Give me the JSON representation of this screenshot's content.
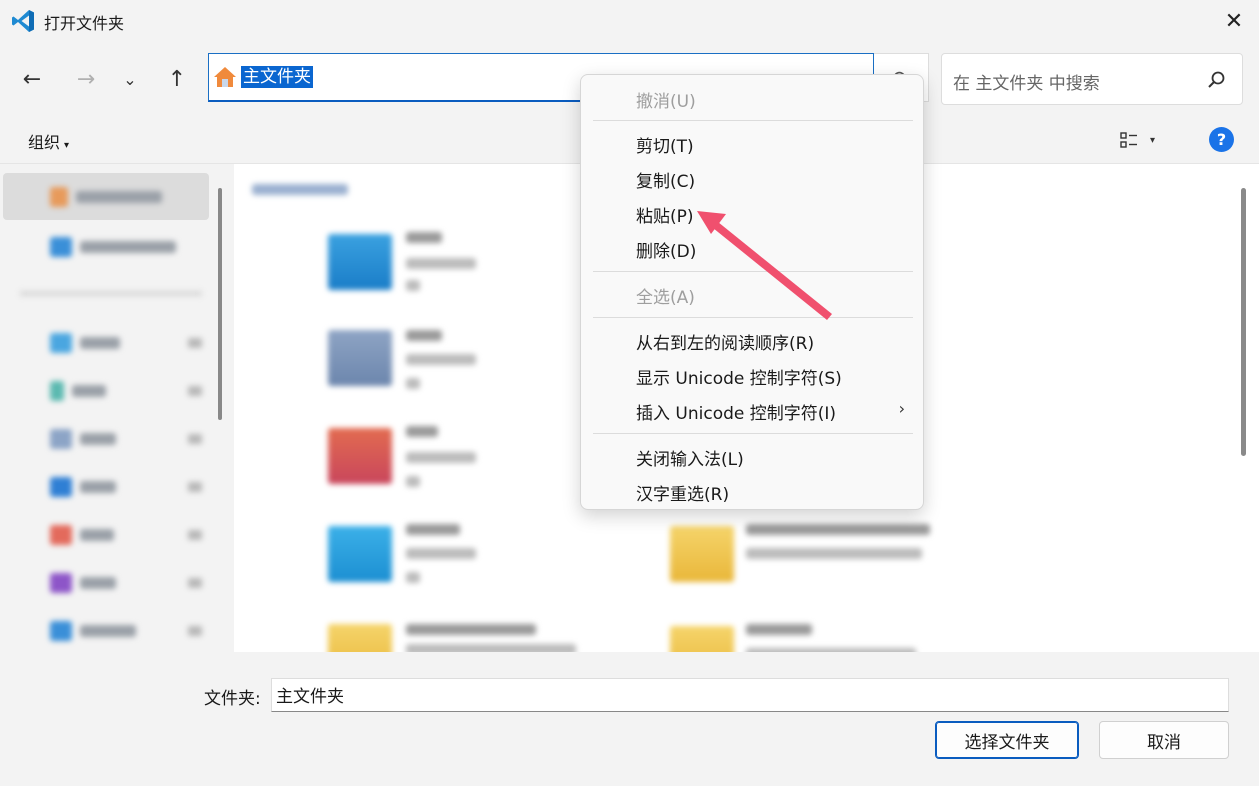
{
  "window": {
    "title": "打开文件夹",
    "close_glyph": "✕"
  },
  "nav": {
    "back_glyph": "←",
    "forward_glyph": "→",
    "recent_glyph": "⌄",
    "up_glyph": "↑",
    "address": "主文件夹",
    "address_chevron": "⌄",
    "refresh_glyph": "⟳",
    "search_placeholder": "在 主文件夹 中搜索"
  },
  "commandbar": {
    "organize": "组织",
    "organize_caret": "▾",
    "view_caret": "▾",
    "help": "?"
  },
  "context_menu": {
    "items": [
      {
        "label": "撤消(U)",
        "enabled": false
      },
      {
        "label": "剪切(T)",
        "enabled": true
      },
      {
        "label": "复制(C)",
        "enabled": true
      },
      {
        "label": "粘贴(P)",
        "enabled": true
      },
      {
        "label": "删除(D)",
        "enabled": true
      },
      {
        "label": "全选(A)",
        "enabled": false
      },
      {
        "label": "从右到左的阅读顺序(R)",
        "enabled": true
      },
      {
        "label": "显示 Unicode 控制字符(S)",
        "enabled": true
      },
      {
        "label": "插入 Unicode 控制字符(I)",
        "enabled": true,
        "has_submenu": true
      },
      {
        "label": "关闭输入法(L)",
        "enabled": true
      },
      {
        "label": "汉字重选(R)",
        "enabled": true
      }
    ],
    "submenu_glyph": "›"
  },
  "footer": {
    "folder_label": "文件夹:",
    "folder_value": "主文件夹",
    "select_button": "选择文件夹",
    "cancel_button": "取消"
  },
  "colors": {
    "accent": "#0a66d0",
    "annotation_arrow": "#f0506e"
  },
  "icons": {
    "app": "vscode-icon",
    "home": "home-icon",
    "search": "search-icon"
  }
}
